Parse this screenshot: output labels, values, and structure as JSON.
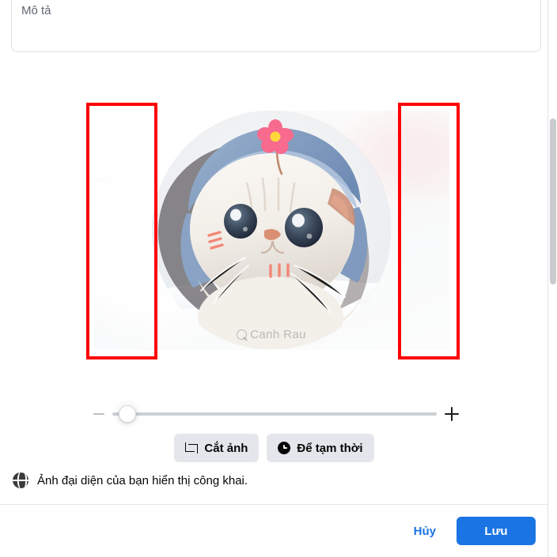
{
  "dialog": {
    "description_field": {
      "placeholder": "Mô tả",
      "value": ""
    },
    "photo": {
      "watermark": "Canh Rau",
      "alt_name": "cat-avatar-preview"
    },
    "zoom_slider": {
      "minus_icon": "minus-icon",
      "plus_icon": "plus-icon",
      "value": 0,
      "min": 0,
      "max": 100
    },
    "actions": [
      {
        "label": "Cắt ảnh",
        "icon": "crop-icon"
      },
      {
        "label": "Để tạm thời",
        "icon": "clock-icon"
      }
    ],
    "notice": {
      "icon": "globe-icon",
      "text": "Ảnh đại diện của bạn hiển thị công khai."
    },
    "footer": {
      "cancel_label": "Hủy",
      "save_label": "Lưu"
    }
  },
  "annotations": [
    {
      "name": "left-crop-region-highlight",
      "color": "#FE0000"
    },
    {
      "name": "right-crop-region-highlight",
      "color": "#FE0000"
    }
  ],
  "colors": {
    "primary_blue": "#1B74E4",
    "chip_gray": "#E4E6EB",
    "annotation_red": "#FE0000",
    "text_primary": "#050505",
    "border": "#DDDFE2"
  }
}
